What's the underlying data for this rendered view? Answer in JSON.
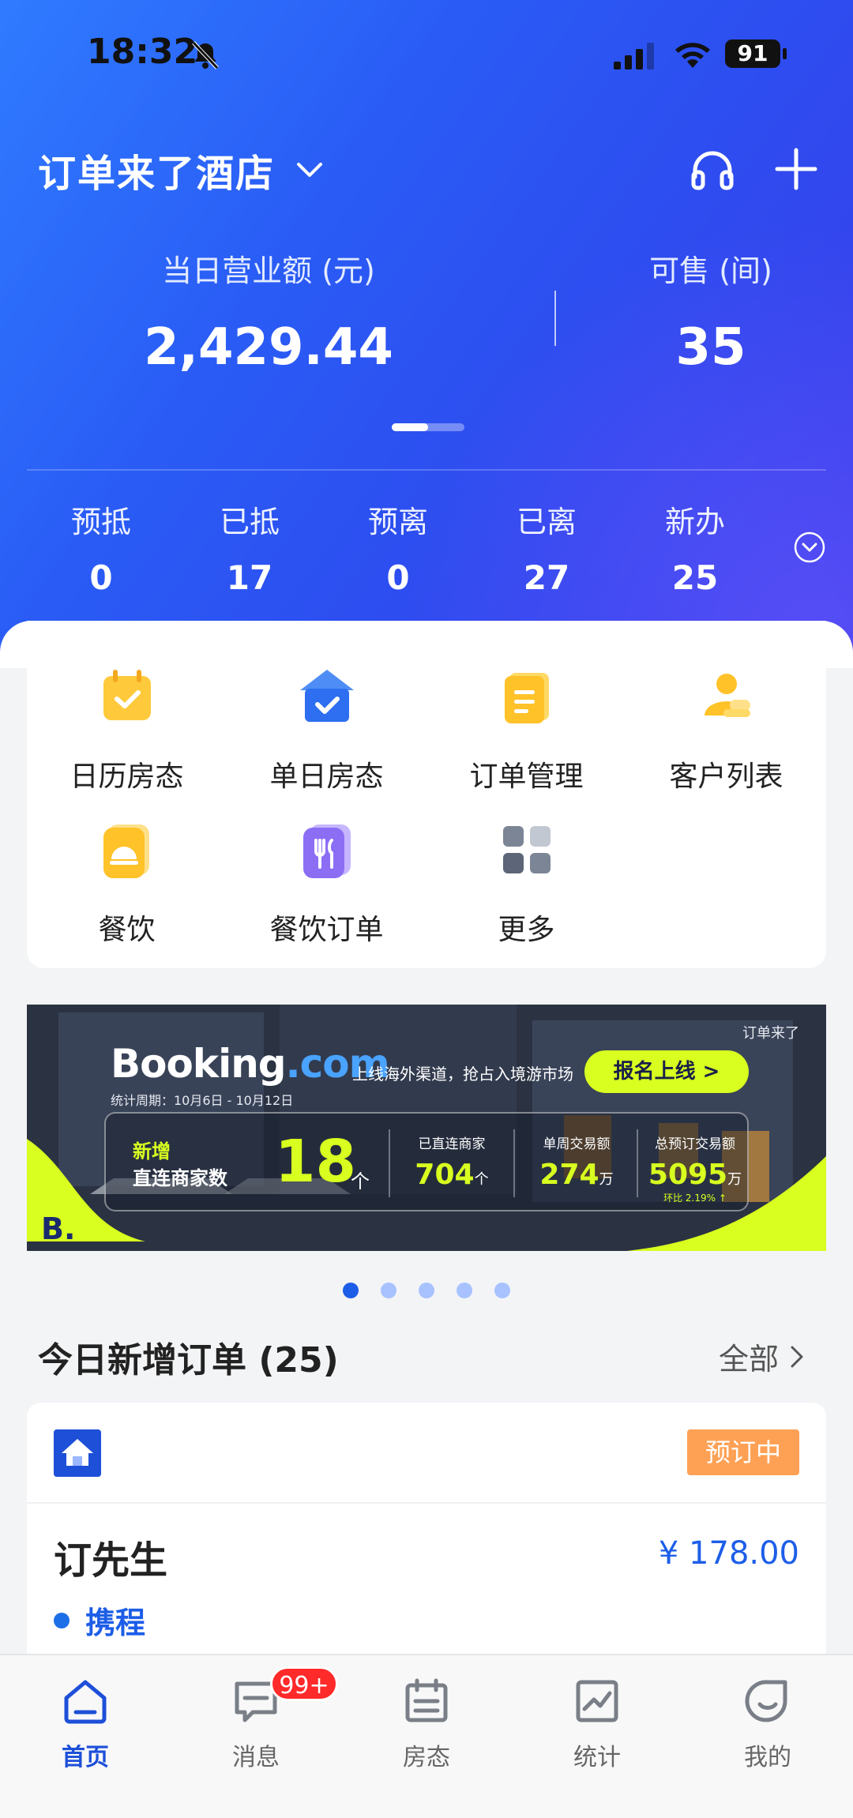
{
  "status_bar": {
    "time": "18:32",
    "battery": "91"
  },
  "header": {
    "hotel_name": "订单来了酒店",
    "revenue_label": "当日营业额 (元)",
    "revenue_value": "2,429.44",
    "available_label": "可售 (间)",
    "available_value": "35",
    "counts": [
      {
        "label": "预抵",
        "value": "0"
      },
      {
        "label": "已抵",
        "value": "17"
      },
      {
        "label": "预离",
        "value": "0"
      },
      {
        "label": "已离",
        "value": "27"
      },
      {
        "label": "新办",
        "value": "25"
      }
    ]
  },
  "grid": [
    {
      "label": "日历房态",
      "icon": "calendar-check-icon"
    },
    {
      "label": "单日房态",
      "icon": "house-check-icon"
    },
    {
      "label": "订单管理",
      "icon": "clipboard-icon"
    },
    {
      "label": "客户列表",
      "icon": "customers-icon"
    },
    {
      "label": "餐饮",
      "icon": "cloche-icon"
    },
    {
      "label": "餐饮订单",
      "icon": "fork-knife-icon"
    },
    {
      "label": "更多",
      "icon": "more-grid-icon"
    }
  ],
  "banner": {
    "brand_small": "订单来了",
    "booking_main": "Booking",
    "booking_dotcom": ".com",
    "slogan": "上线海外渠道，抢占入境游市场",
    "cta": "报名上线 >",
    "period": "统计周期：10月6日 - 10月12日",
    "new_line1": "新增",
    "new_line2": "直连商家数",
    "new_value": "18",
    "new_unit": "个",
    "stats": [
      {
        "title": "已直连商家",
        "value": "704",
        "unit": "个",
        "sub": ""
      },
      {
        "title": "单周交易额",
        "value": "274",
        "unit": "万",
        "sub": ""
      },
      {
        "title": "总预订交易额",
        "value": "5095",
        "unit": "万",
        "sub": "环比 2.19% ↑"
      }
    ],
    "corner_letter": "B."
  },
  "carousel": {
    "count": 5,
    "active": 0
  },
  "orders": {
    "title": "今日新增订单 (25)",
    "all_label": "全部",
    "items": [
      {
        "status": "预订中",
        "guest": "订先生",
        "price": "¥ 178.00",
        "source": "携程"
      }
    ]
  },
  "tabbar": {
    "tabs": [
      {
        "label": "首页",
        "icon": "home-icon",
        "active": true
      },
      {
        "label": "消息",
        "icon": "message-icon",
        "active": false,
        "badge": "99+"
      },
      {
        "label": "房态",
        "icon": "calendar-icon",
        "active": false
      },
      {
        "label": "统计",
        "icon": "chart-icon",
        "active": false
      },
      {
        "label": "我的",
        "icon": "profile-icon",
        "active": false
      }
    ]
  },
  "colors": {
    "primary": "#1d4fd8",
    "header_blue": "#2d4ef0",
    "badge_orange": "#ffa155",
    "accent_lime": "#d8ff1f",
    "notification_red": "#ff2a2a"
  }
}
